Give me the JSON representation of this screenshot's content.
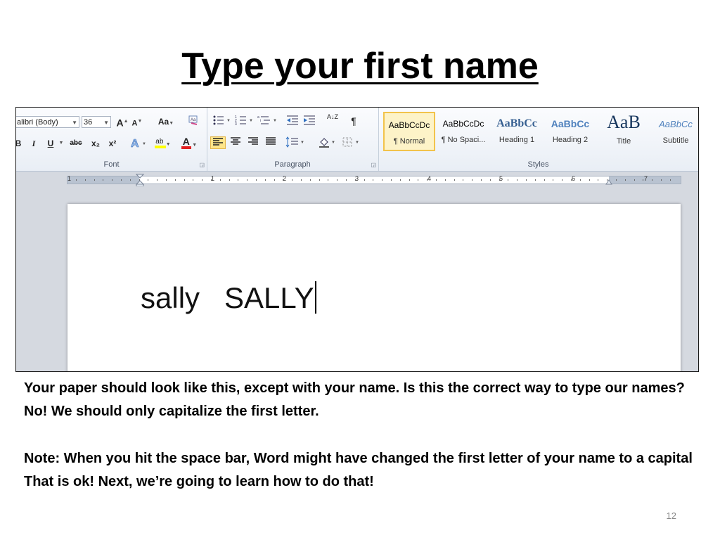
{
  "slide": {
    "title": "Type your first name",
    "page_number": "12",
    "paragraphs": [
      "Your paper should look like this, except with your name.  Is this the correct way to type our names?  No!  We should only capitalize the first letter.",
      "Note:  When you hit the space bar, Word might have changed the first letter of your name to a capital  That is ok!  Next, we’re going to learn how to do that!"
    ]
  },
  "ribbon": {
    "font_group": {
      "label": "Font",
      "font_name": "alibri (Body)",
      "font_size": "36",
      "grow_label": "A",
      "shrink_label": "A",
      "change_case_label": "Aa",
      "bold": "B",
      "italic": "I",
      "underline": "U",
      "strikethrough": "abc",
      "subscript": "x₂",
      "superscript": "x²",
      "highlight_label": "ab",
      "font_color_label": "A"
    },
    "paragraph_group": {
      "label": "Paragraph",
      "sort_label": "A↓Z",
      "show_marks": "¶"
    },
    "styles_group": {
      "label": "Styles",
      "items": [
        {
          "sample": "AaBbCcDc",
          "name": "¶ Normal"
        },
        {
          "sample": "AaBbCcDc",
          "name": "¶ No Spaci..."
        },
        {
          "sample": "AaBbCc",
          "name": "Heading 1"
        },
        {
          "sample": "AaBbCc",
          "name": "Heading 2"
        },
        {
          "sample": "AaB",
          "name": "Title"
        },
        {
          "sample": "AaBbCc",
          "name": "Subtitle"
        }
      ]
    }
  },
  "ruler": {
    "numbers": [
      "1",
      "1",
      "2",
      "3",
      "4",
      "5",
      "6",
      "7"
    ]
  },
  "document": {
    "text": "sally   SALLY"
  },
  "colors": {
    "ribbon_bg": "#e9eef5",
    "selected_button": "#fde58a",
    "heading_blue": "#365f91",
    "subtitle_blue": "#4f81bd"
  }
}
